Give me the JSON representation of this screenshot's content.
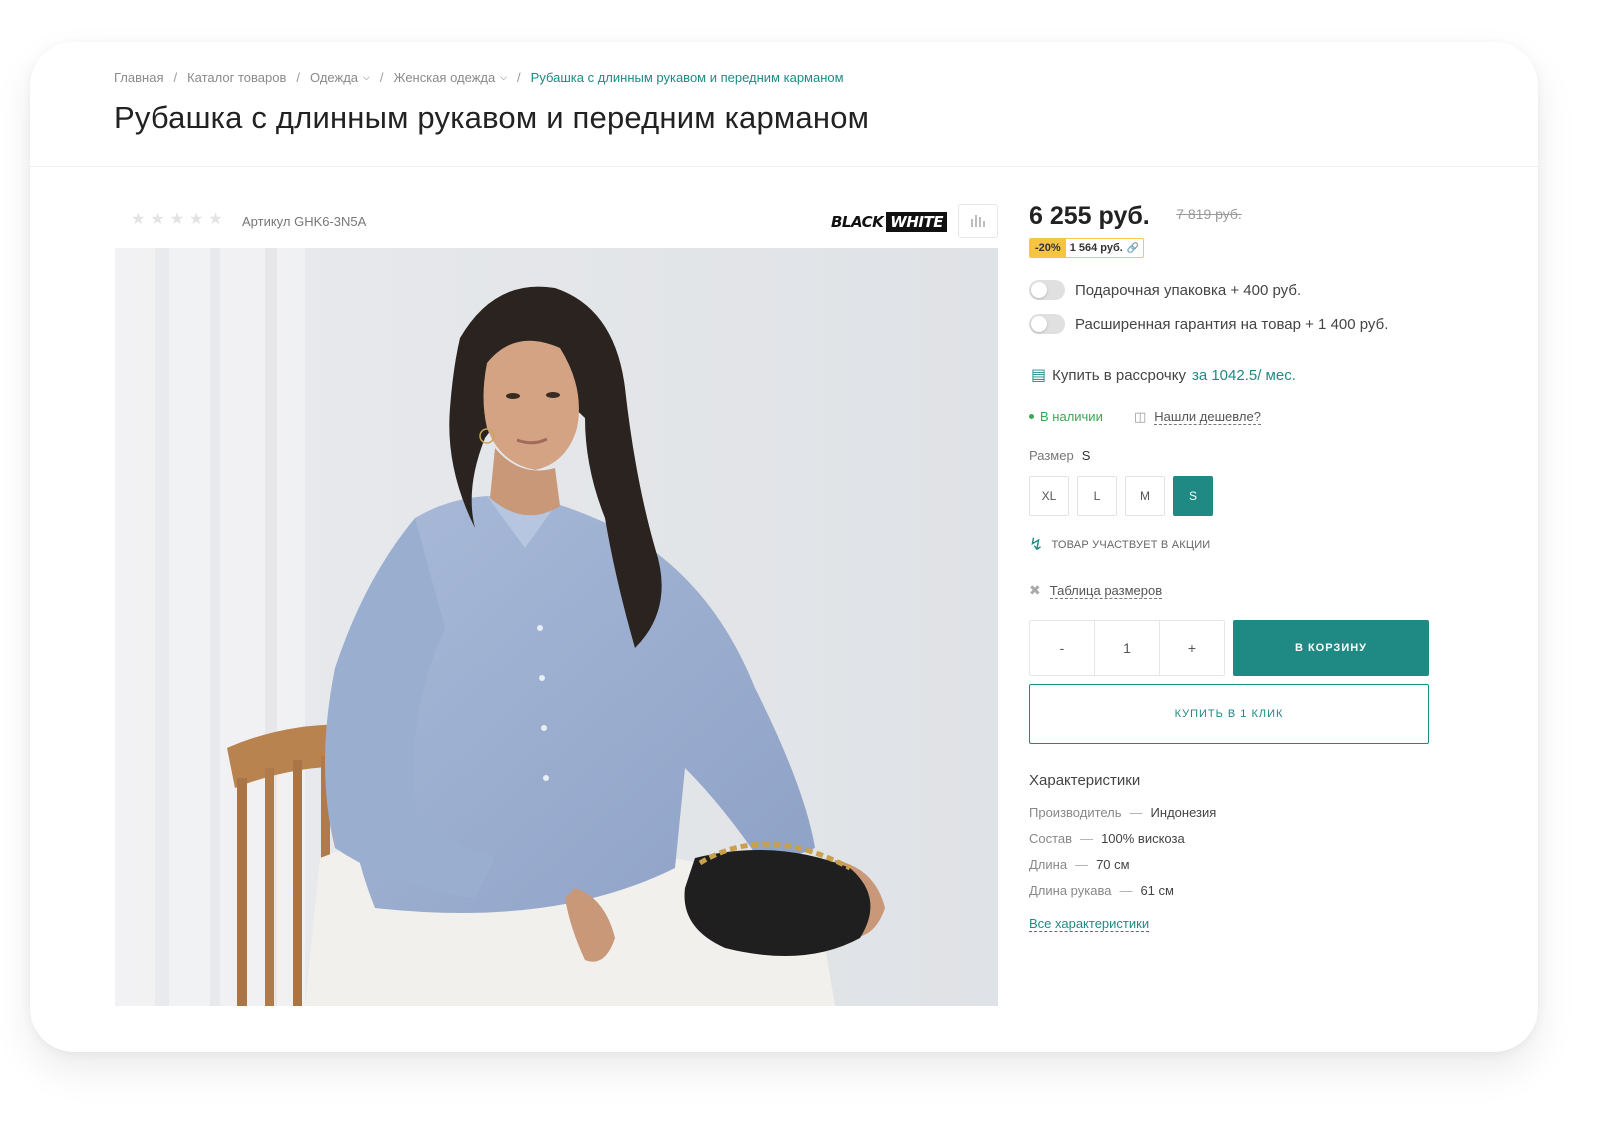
{
  "breadcrumbs": [
    {
      "label": "Главная"
    },
    {
      "label": "Каталог товаров"
    },
    {
      "label": "Одежда"
    },
    {
      "label": "Женская одежда"
    },
    {
      "label": "Рубашка с длинным рукавом и передним карманом"
    }
  ],
  "breadcrumb_separator": "/",
  "product": {
    "title": "Рубашка с длинным рукавом и передним карманом",
    "rating": 0,
    "article": "Артикул GHK6-3N5A",
    "brand": {
      "part1": "BLACK",
      "part2": "WHITE"
    },
    "photo_alt": "Женщина в голубой рубашке сидит на стуле"
  },
  "price": {
    "current": "6 255 руб.",
    "old": "7 819 руб.",
    "discount_percent": "-20%",
    "savings": "1 564 руб."
  },
  "options": [
    {
      "label": "Подарочная упаковка + 400 руб.",
      "enabled": false
    },
    {
      "label": "Расширенная гарантия на товар + 1 400 руб.",
      "enabled": false
    }
  ],
  "installment": {
    "text": "Купить в рассрочку",
    "link": "за 1042.5/ мес."
  },
  "stock": {
    "status": "В наличии",
    "cheaper": "Нашли дешевле?"
  },
  "size": {
    "label": "Размер",
    "selected": "S",
    "options": [
      "XL",
      "L",
      "M",
      "S"
    ]
  },
  "promo_text": "Товар участвует в акции",
  "size_table_link": "Таблица размеров",
  "quantity": {
    "minus": "-",
    "value": "1",
    "plus": "+"
  },
  "buttons": {
    "cart": "В корзину",
    "one_click": "Купить в 1 клик"
  },
  "characteristics": {
    "title": "Характеристики",
    "dash": "—",
    "items": [
      {
        "key": "Производитель",
        "value": "Индонезия"
      },
      {
        "key": "Состав",
        "value": "100% вискоза"
      },
      {
        "key": "Длина",
        "value": "70 см"
      },
      {
        "key": "Длина рукава",
        "value": "61 см"
      }
    ],
    "all_link": "Все характеристики"
  },
  "colors": {
    "accent": "#1f8a84",
    "in_stock": "#3aa757",
    "discount": "#f5c542"
  },
  "icons": {
    "compare": "bar-chart-icon",
    "installment": "installment-icon",
    "cheaper": "wallet-icon",
    "promo": "lightning-icon",
    "size_table": "ruler-icon",
    "breadcrumb_chevron": "chevron-down-icon"
  }
}
